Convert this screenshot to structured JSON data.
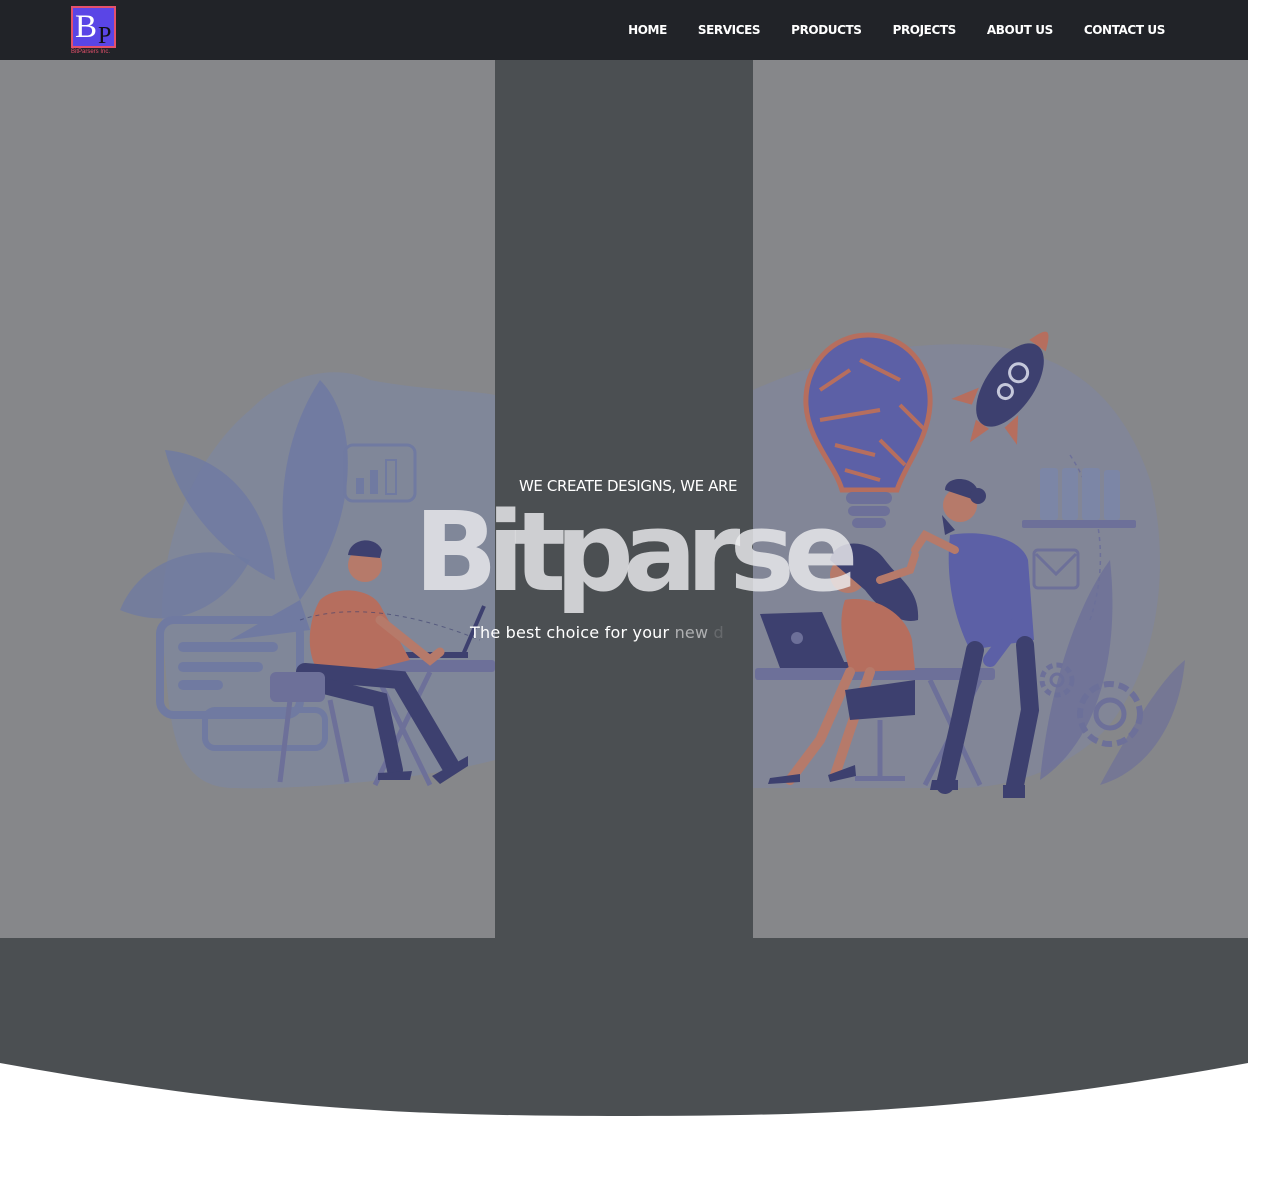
{
  "brand": {
    "logo_letter_b": "B",
    "logo_letter_p": "P",
    "logo_tagline": "BitParsers Inc.",
    "logo_bg": "#5a45e6",
    "logo_border": "#e4506b"
  },
  "nav": {
    "items": [
      {
        "label": "HOME"
      },
      {
        "label": "SERVICES"
      },
      {
        "label": "PRODUCTS"
      },
      {
        "label": "PROJECTS"
      },
      {
        "label": "ABOUT US"
      },
      {
        "label": "CONTACT US"
      }
    ],
    "bg": "#212328"
  },
  "hero": {
    "kicker": "WE CREATE DESIGNS, WE ARE",
    "headline": "Bitparse",
    "subtitle_main": "The best choice for your ",
    "subtitle_fade1": "new",
    "subtitle_fade2": " d",
    "overlay_dark": "#4b4f52",
    "overlay_light": "#86878a"
  },
  "colors": {
    "illustration_blue": "#7c86a8",
    "illustration_navy": "#3a3d6e",
    "accent_orange": "#b96d5c",
    "accent_purple": "#5a5ea8"
  },
  "icons": [
    "chart-icon",
    "envelope-icon",
    "gear-icon",
    "rocket-icon",
    "lightbulb-puzzle-icon",
    "laptop-icon"
  ]
}
